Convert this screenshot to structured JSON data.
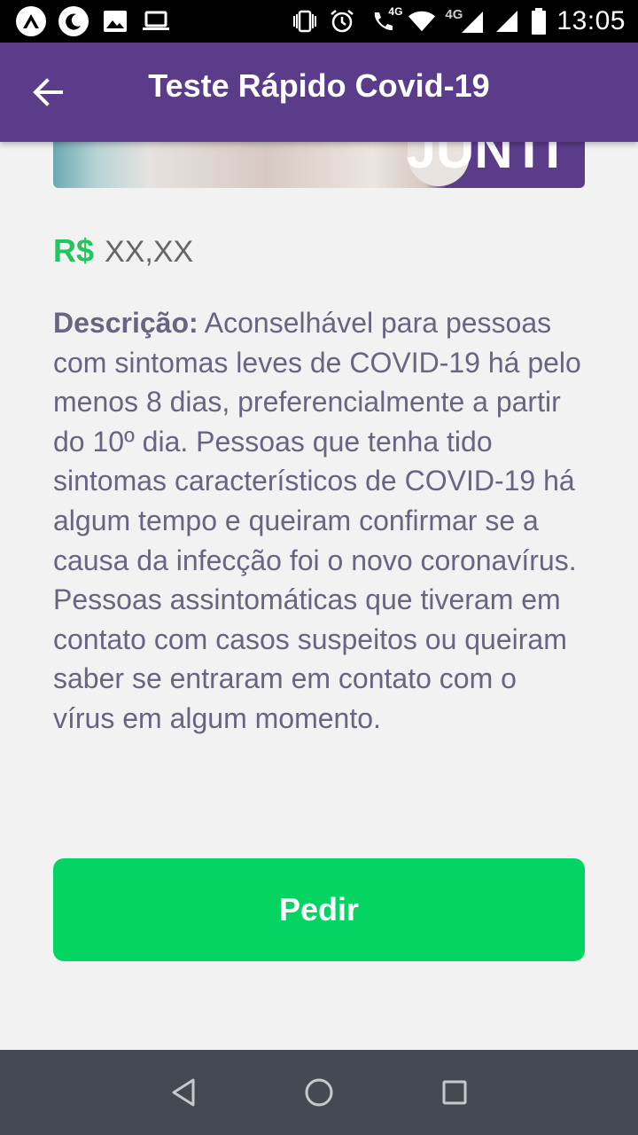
{
  "status_bar": {
    "left_icons": [
      "app-a-icon",
      "moon-icon",
      "image-icon",
      "laptop-icon"
    ],
    "right_icons": [
      "vibrate-icon",
      "alarm-icon",
      "wifi-call-icon",
      "wifi-icon",
      "signal-icon",
      "signal-icon",
      "battery-icon"
    ],
    "call_label": "4G",
    "network_label": "4G",
    "time": "13:05"
  },
  "app_bar": {
    "title": "Teste Rápido Covid-19",
    "back_icon": "arrow-back-icon"
  },
  "banner": {
    "partial_text": "JUNTI"
  },
  "product": {
    "currency": "R$",
    "price": "XX,XX",
    "description_label": "Descrição:",
    "description_text": "Aconselhável para pessoas com sintomas leves de COVID-19 há pelo menos 8 dias, preferencialmente a partir do 10º dia. Pessoas que tenha tido sintomas característicos de COVID-19 há algum tempo e queiram confirmar se a causa da infecção foi o novo coronavírus. Pessoas assintomáticas que tiveram em contato com casos suspeitos ou queiram saber se entraram em contato com o vírus em algum momento."
  },
  "actions": {
    "order_label": "Pedir"
  },
  "nav_bar": {
    "icons": [
      "back-triangle-icon",
      "home-circle-icon",
      "recents-square-icon"
    ]
  },
  "colors": {
    "primary": "#5b3c8b",
    "accent_green": "#03d462",
    "price_green": "#22c55e",
    "text": "#6b6480"
  }
}
